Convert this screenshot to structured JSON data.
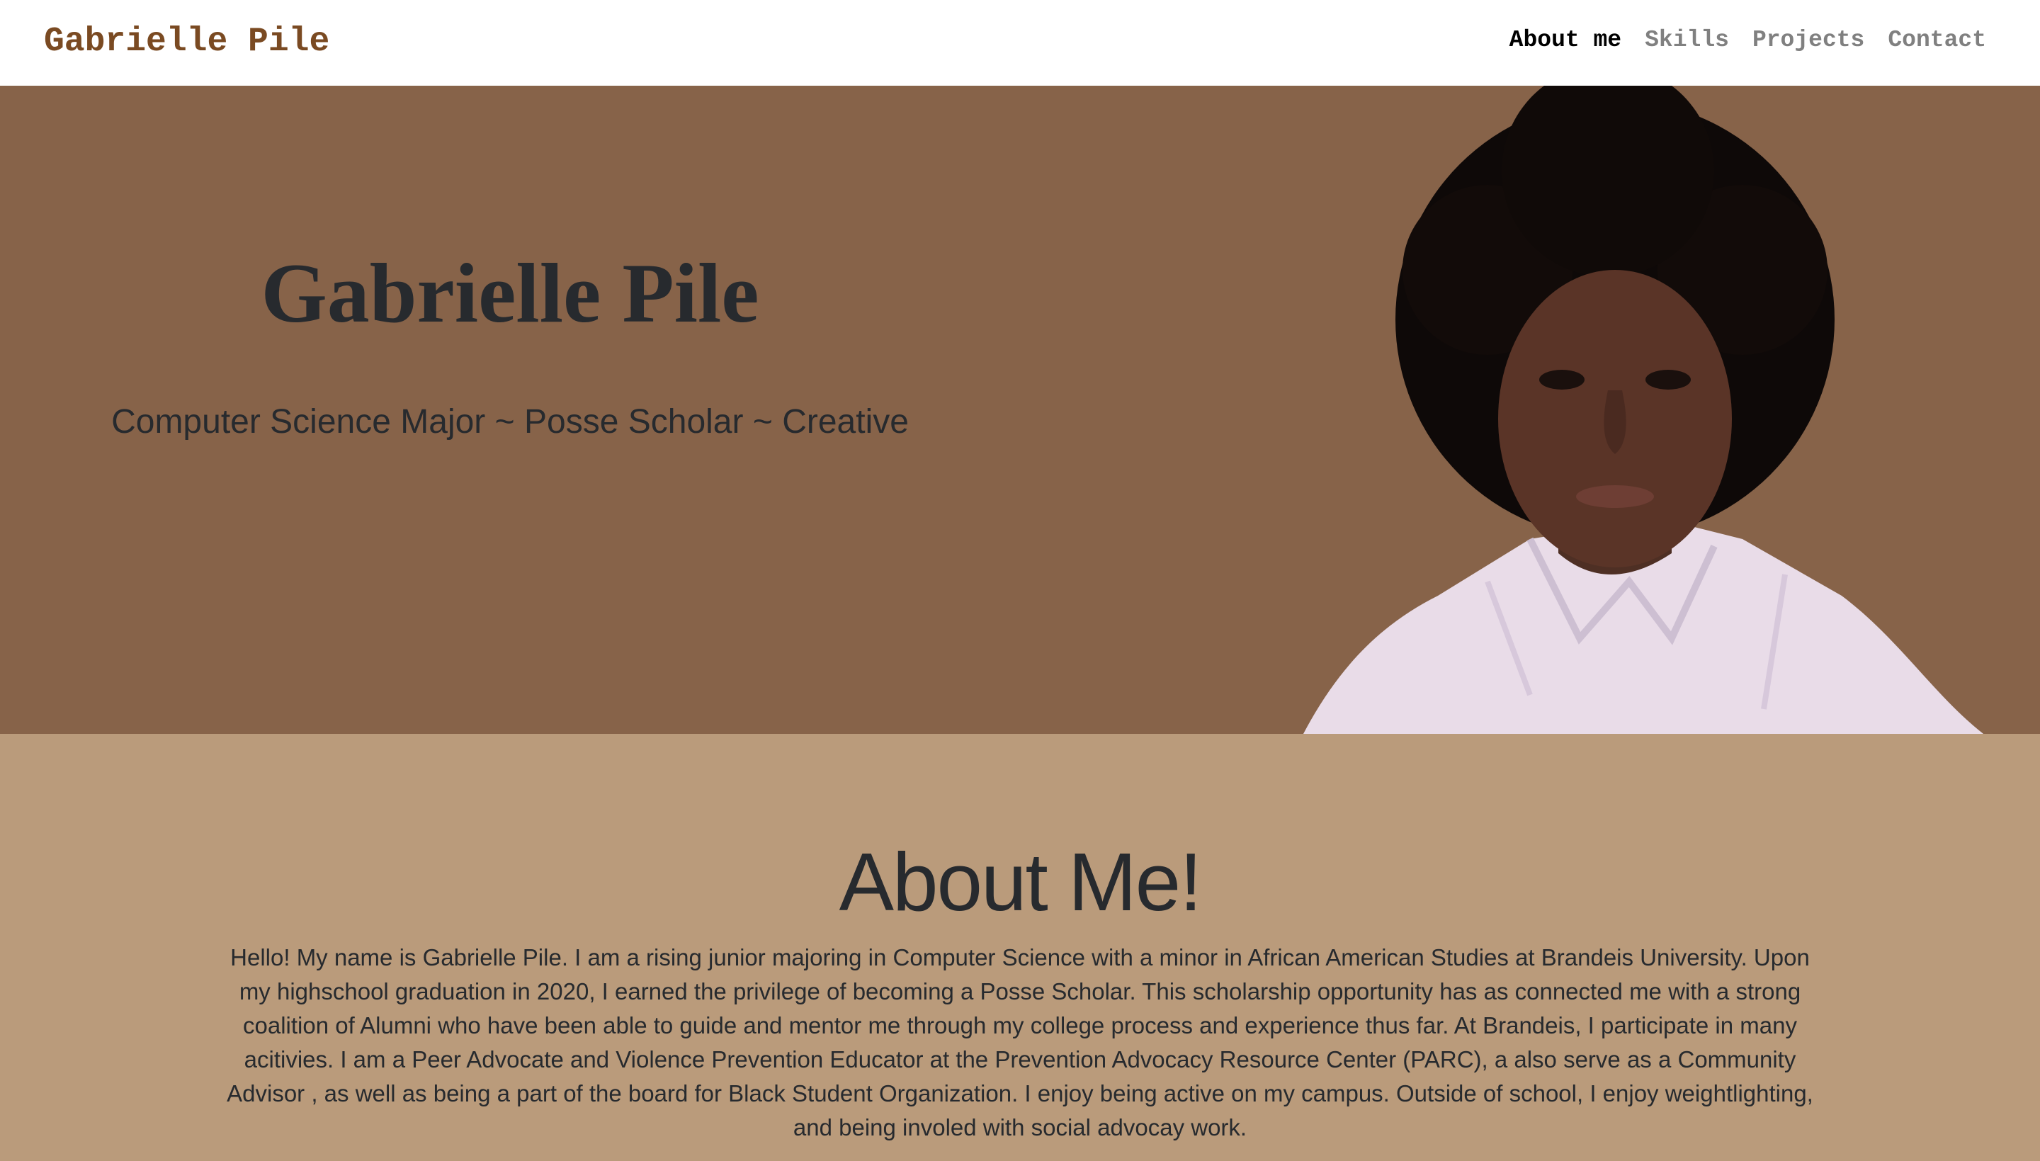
{
  "navbar": {
    "brand": "Gabrielle Pile",
    "links": [
      {
        "label": "About me",
        "active": true
      },
      {
        "label": "Skills",
        "active": false
      },
      {
        "label": "Projects",
        "active": false
      },
      {
        "label": "Contact",
        "active": false
      }
    ]
  },
  "hero": {
    "title": "Gabrielle Pile",
    "subtitle": "Computer Science Major ~ Posse Scholar ~ Creative"
  },
  "about": {
    "title": "About Me!",
    "text": "Hello! My name is Gabrielle Pile. I am a rising junior majoring in Computer Science with a minor in African American Studies at Brandeis University. Upon my highschool graduation in 2020, I earned the privilege of becoming a Posse Scholar. This scholarship opportunity has as connected me with a strong coalition of Alumni who have been able to guide and mentor me through my college process and experience thus far. At Brandeis, I participate in many acitivies. I am a Peer Advocate and Violence Prevention Educator at the Prevention Advocacy Resource Center (PARC), a also serve as a Community Advisor , as well as being a part of the board for Black Student Organization. I enjoy being active on my campus. Outside of school, I enjoy weightlighting, and being involed with social advocay work."
  },
  "colors": {
    "navbar_bg": "#ffffff",
    "brand": "#7a4a22",
    "hero_bg": "#876349",
    "about_bg": "#ba9b7b",
    "heading_text": "#272a2e"
  }
}
